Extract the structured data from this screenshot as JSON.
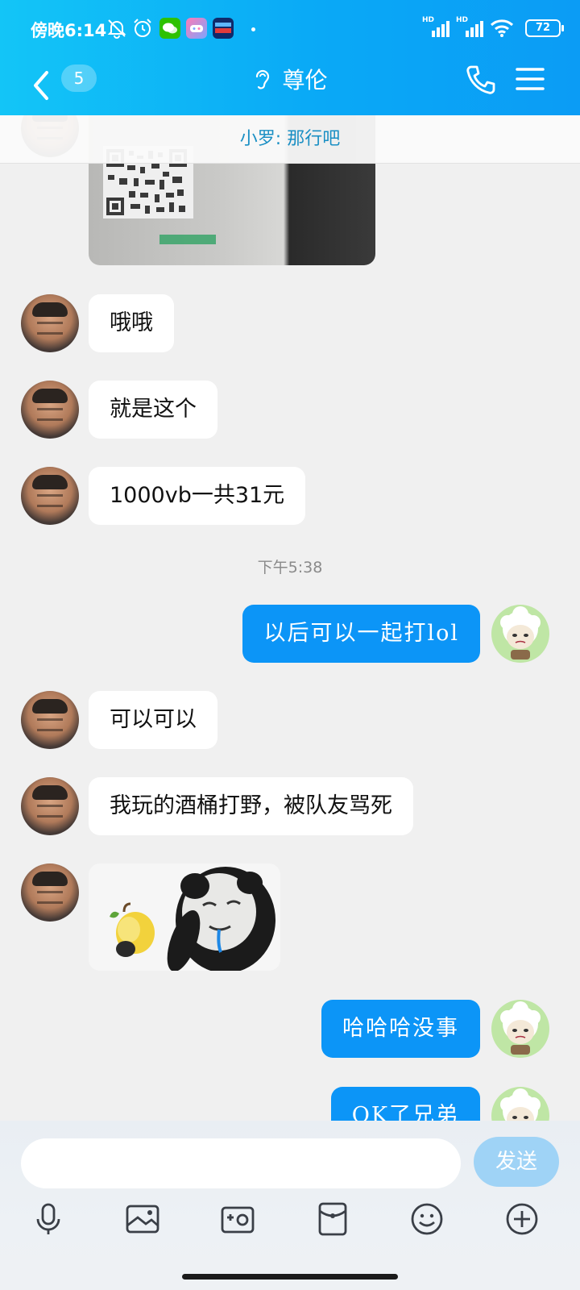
{
  "status_bar": {
    "time": "傍晚6:14",
    "battery": "72",
    "signal_labels": [
      "HD",
      "HD"
    ]
  },
  "header": {
    "unread_count": "5",
    "title": "尊伦"
  },
  "chat": {
    "quote_banner": "小罗: 那行吧",
    "messages": [
      {
        "from": "friend",
        "type": "image",
        "content": "qr-code-photo"
      },
      {
        "from": "friend",
        "type": "text",
        "text": "哦哦"
      },
      {
        "from": "friend",
        "type": "text",
        "text": "就是这个"
      },
      {
        "from": "friend",
        "type": "text",
        "text": "1000vb一共31元"
      },
      {
        "type": "timestamp",
        "text": "下午5:38"
      },
      {
        "from": "me",
        "type": "text",
        "text": "以后可以一起打lol"
      },
      {
        "from": "friend",
        "type": "text",
        "text": "可以可以"
      },
      {
        "from": "friend",
        "type": "text",
        "text": "我玩的酒桶打野，被队友骂死"
      },
      {
        "from": "friend",
        "type": "image",
        "content": "panda-meme-sticker"
      },
      {
        "from": "me",
        "type": "text",
        "text": "哈哈哈没事"
      },
      {
        "from": "me",
        "type": "text",
        "text": "OK了兄弟"
      }
    ]
  },
  "input": {
    "placeholder": "",
    "send_label": "发送"
  },
  "toolbar": [
    "microphone-icon",
    "picture-icon",
    "camera-icon",
    "red-packet-icon",
    "emoji-icon",
    "plus-icon"
  ],
  "colors": {
    "header_gradient_start": "#13c5f7",
    "header_gradient_end": "#0b9cf5",
    "outgoing_bubble": "#0c95f7",
    "incoming_bubble": "#ffffff",
    "send_button": "#9fd3f6"
  }
}
